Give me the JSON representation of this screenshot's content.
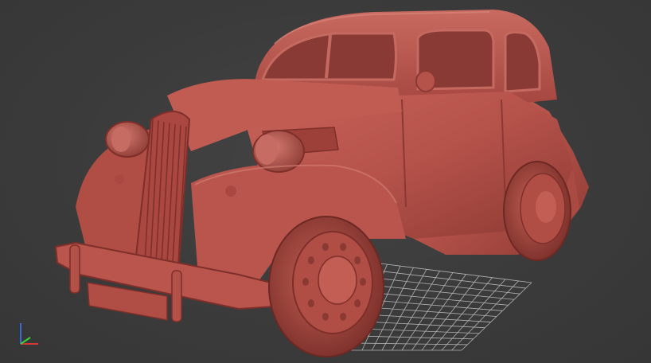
{
  "viewport": {
    "background_color": "#3c3c3c",
    "grid_color": "#c8c8c8",
    "model_color": "#b5524a",
    "model_shadow_color": "#7e2f2a",
    "model_highlight_color": "#cf7066",
    "window_interior_color": "#8a3a35",
    "view_mode": "perspective",
    "shading": "matcap-clay",
    "grid_visible": true
  },
  "axis_gizmo": {
    "x_axis_color": "#d23a3a",
    "y_axis_color": "#3ad23a",
    "z_axis_color": "#3a6ad2",
    "icon": "axis-tripod-icon"
  },
  "model": {
    "subject": "vintage-sedan-car",
    "icon": "car-model-3d"
  }
}
